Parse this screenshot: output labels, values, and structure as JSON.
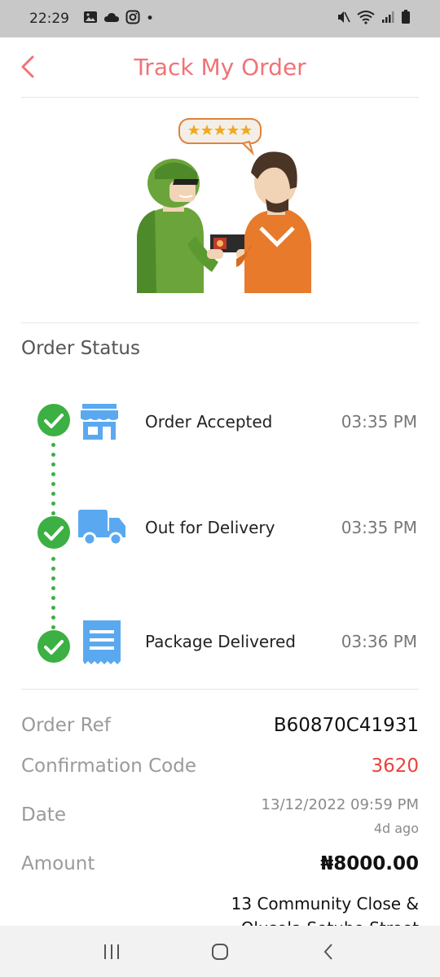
{
  "status_bar": {
    "time": "22:29",
    "dot": "•"
  },
  "header": {
    "title": "Track My Order",
    "accent_color": "#f07377"
  },
  "section_title": "Order Status",
  "steps": [
    {
      "label": "Order Accepted",
      "time": "03:35 PM",
      "icon": "store-icon"
    },
    {
      "label": "Out for Delivery",
      "time": "03:35 PM",
      "icon": "delivery-truck-icon"
    },
    {
      "label": "Package Delivered",
      "time": "03:36 PM",
      "icon": "receipt-icon"
    }
  ],
  "details": {
    "order_ref_label": "Order Ref",
    "order_ref_value": "B60870C41931",
    "confirmation_label": "Confirmation Code",
    "confirmation_value": "3620",
    "date_label": "Date",
    "date_value": "13/12/2022 09:59 PM",
    "date_ago": "4d ago",
    "amount_label": "Amount",
    "amount_value": "₦8000.00",
    "address_line1": "13 Community Close &",
    "address_line2": "Olusola Sotubo Street"
  },
  "colors": {
    "check_green": "#3cb043",
    "icon_blue": "#5aa9f0",
    "code_red": "#e9433f"
  }
}
